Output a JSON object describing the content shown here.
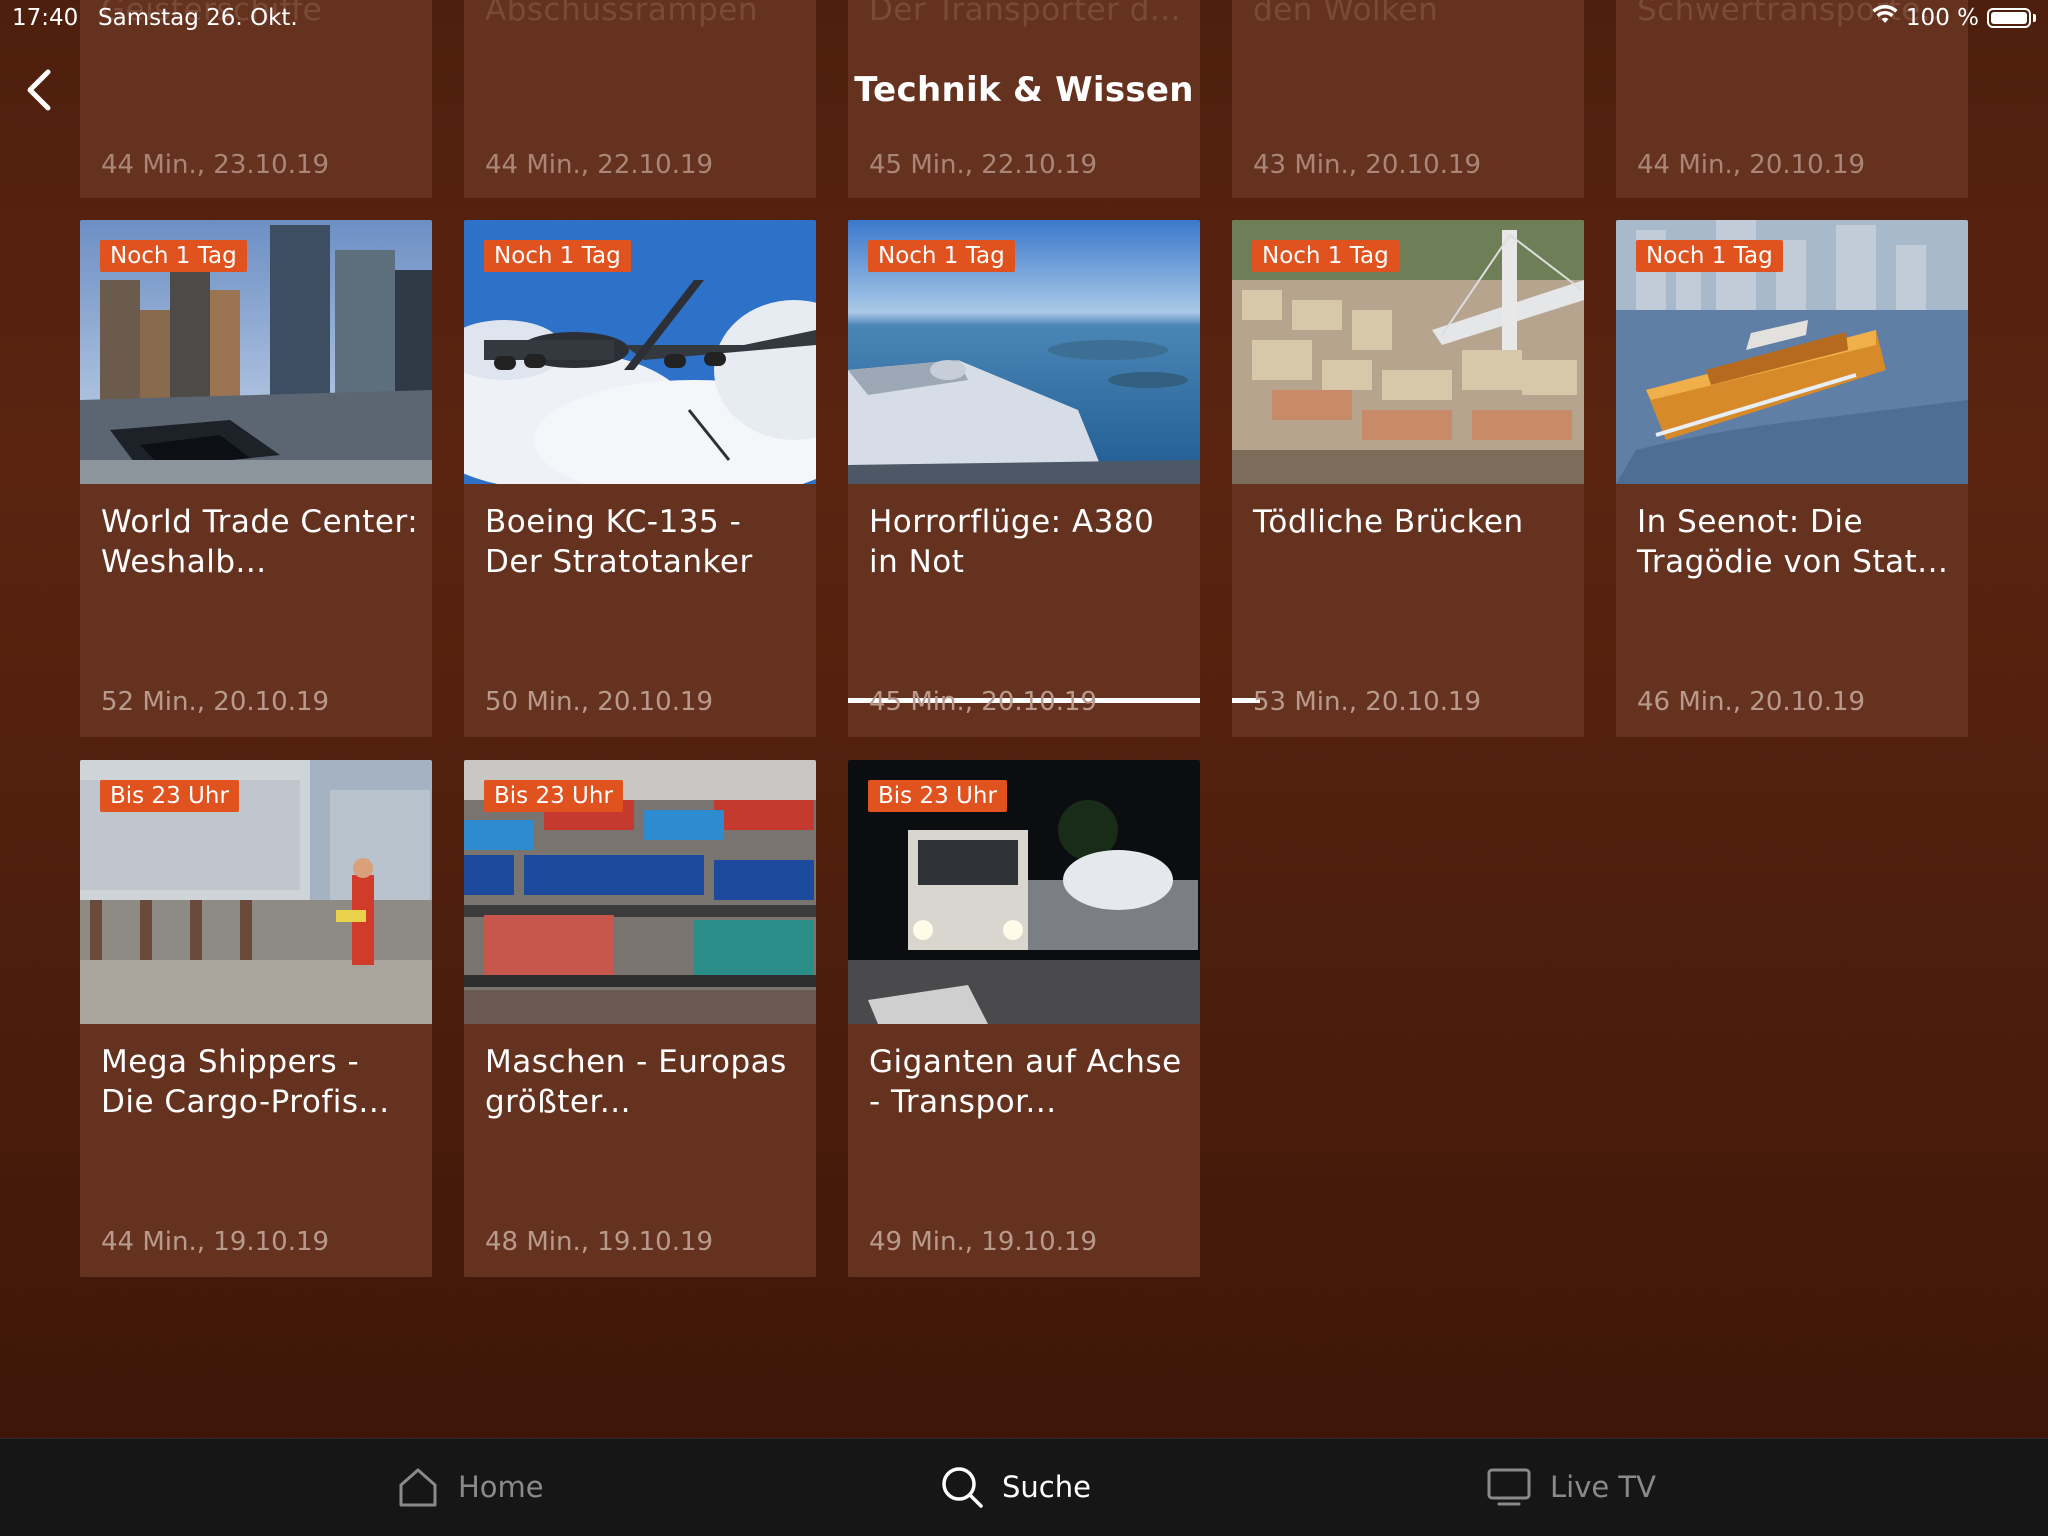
{
  "status": {
    "time": "17:40",
    "date": "Samstag 26. Okt.",
    "battery": "100 %"
  },
  "header": {
    "title": "Technik & Wissen"
  },
  "top_row": [
    {
      "title": "Geisterschiffe",
      "meta": "44 Min., 23.10.19"
    },
    {
      "title": "Abschussrampen",
      "meta": "44 Min., 22.10.19"
    },
    {
      "title": "Der Transporter d...",
      "meta": "45 Min., 22.10.19"
    },
    {
      "title": "den Wolken",
      "meta": "43 Min., 20.10.19"
    },
    {
      "title": "Schwertransporte...",
      "meta": "44 Min., 20.10.19"
    }
  ],
  "cards": [
    {
      "badge": "Noch 1 Tag",
      "title": "World Trade Center: Weshalb...",
      "meta": "52 Min., 20.10.19",
      "progress": 0
    },
    {
      "badge": "Noch 1 Tag",
      "title": "Boeing KC-135 - Der Stratotanker",
      "meta": "50 Min., 20.10.19",
      "progress": 0
    },
    {
      "badge": "Noch 1 Tag",
      "title": "Horrorflüge: A380 in Not",
      "meta": "45 Min., 20.10.19",
      "progress": 1.0
    },
    {
      "badge": "Noch 1 Tag",
      "title": "Tödliche Brücken",
      "meta": "53 Min., 20.10.19",
      "progress": 0.08
    },
    {
      "badge": "Noch 1 Tag",
      "title": "In Seenot: Die Tragödie von Stat...",
      "meta": "46 Min., 20.10.19",
      "progress": 0
    },
    {
      "badge": "Bis 23 Uhr",
      "title": "Mega Shippers - Die Cargo-Profis...",
      "meta": "44 Min., 19.10.19",
      "progress": 0
    },
    {
      "badge": "Bis 23 Uhr",
      "title": "Maschen - Europas größter...",
      "meta": "48 Min., 19.10.19",
      "progress": 0
    },
    {
      "badge": "Bis 23 Uhr",
      "title": "Giganten auf Achse - Transpor...",
      "meta": "49 Min., 19.10.19",
      "progress": 0
    }
  ],
  "tabs": [
    {
      "label": "Home",
      "icon": "home-icon",
      "active": false
    },
    {
      "label": "Suche",
      "icon": "search-icon",
      "active": true
    },
    {
      "label": "Live TV",
      "icon": "tv-icon",
      "active": false
    }
  ],
  "colors": {
    "background": "#4e1f0d",
    "card": "#663220",
    "badge": "#e0531f",
    "tabbar": "#161616"
  }
}
